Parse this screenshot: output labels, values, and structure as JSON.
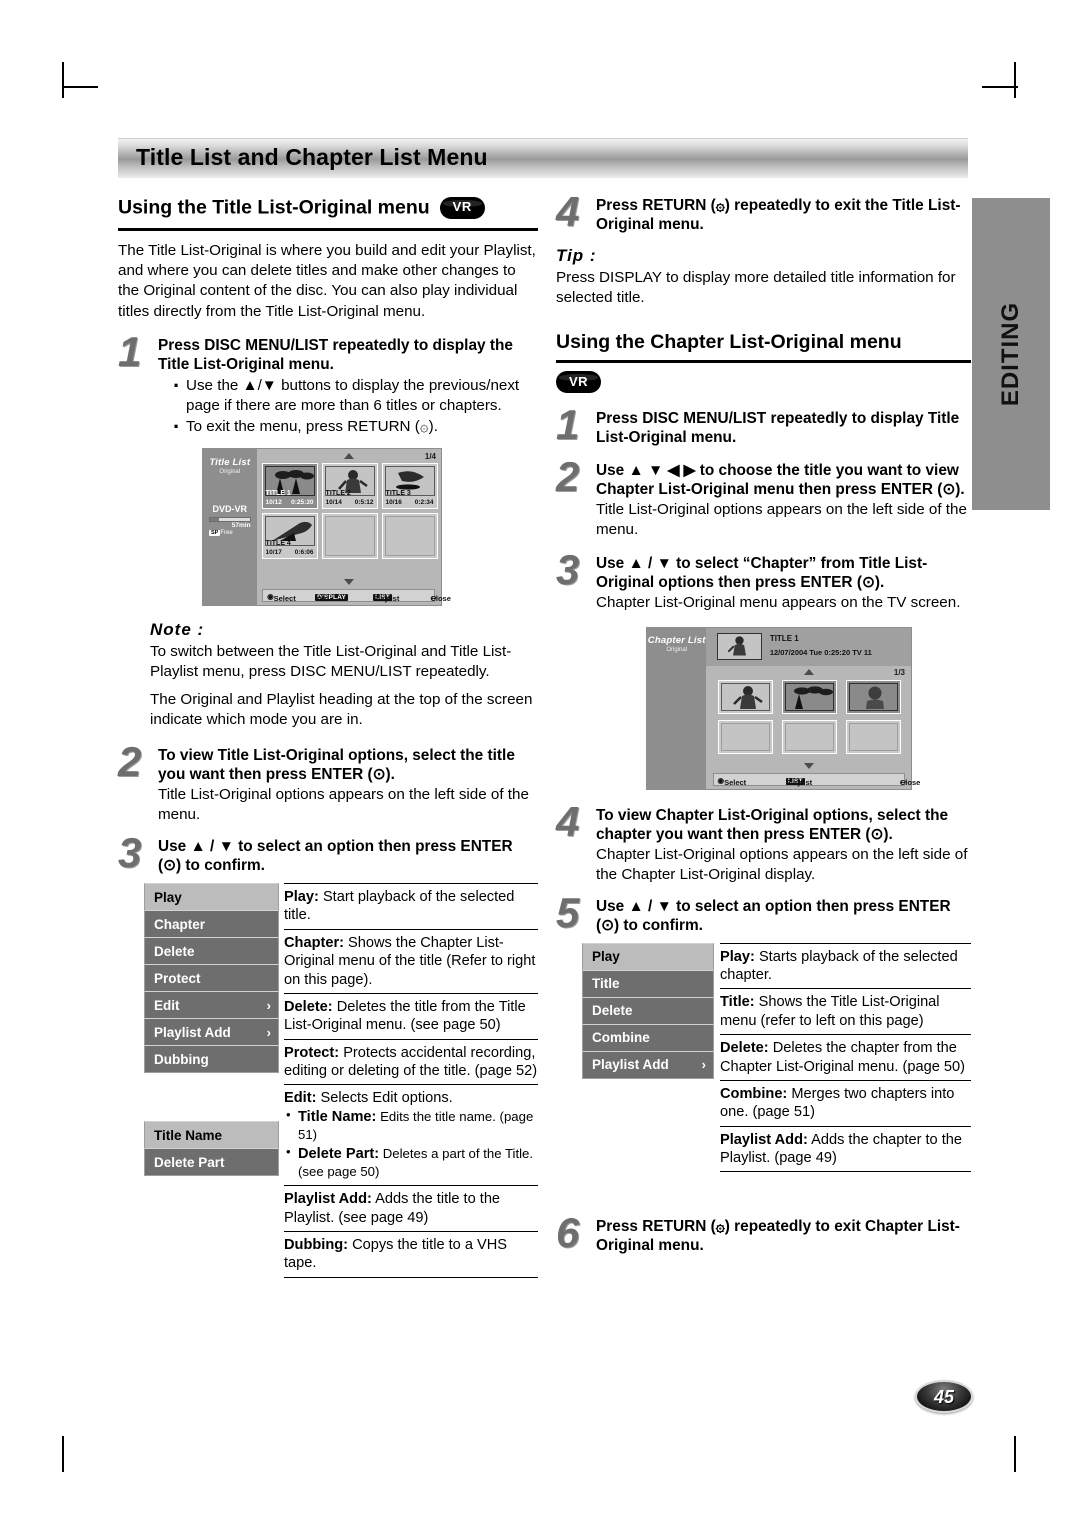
{
  "page": {
    "number": "45",
    "side_tab": "EDITING",
    "title": "Title List and Chapter List Menu"
  },
  "left": {
    "section_heading": "Using the Title List-Original menu",
    "vr_badge": "VR",
    "intro": "The Title List-Original is where you build and edit your Playlist, and where you can delete titles and make other changes to the Original content of the disc. You can also play individual titles directly from the Title List-Original menu.",
    "step1": {
      "num": "1",
      "head": "Press DISC MENU/LIST repeatedly to display the Title List-Original menu.",
      "bullets": [
        "Use the ▲/▼ buttons to display the previous/next page if there are more than 6 titles or chapters.",
        "To exit the menu, press RETURN (۞)."
      ]
    },
    "note": {
      "label": "Note :",
      "para1": "To switch between the Title List-Original and Title List-Playlist menu, press DISC MENU/LIST repeatedly.",
      "para2": "The Original and Playlist heading at the top of the screen indicate which mode you are in."
    },
    "step2": {
      "num": "2",
      "head": "To view Title List-Original options, select the title you want then press ENTER (⊙).",
      "sub": "Title List-Original options appears on the left side of the menu."
    },
    "step3": {
      "num": "3",
      "head": "Use ▲ / ▼ to select an option then press ENTER (⊙) to confirm."
    },
    "options_menu": [
      {
        "label": "Play",
        "selected": true,
        "chevron": false
      },
      {
        "label": "Chapter",
        "selected": false,
        "chevron": false
      },
      {
        "label": "Delete",
        "selected": false,
        "chevron": false
      },
      {
        "label": "Protect",
        "selected": false,
        "chevron": false
      },
      {
        "label": "Edit",
        "selected": false,
        "chevron": true
      },
      {
        "label": "Playlist Add",
        "selected": false,
        "chevron": true
      },
      {
        "label": "Dubbing",
        "selected": false,
        "chevron": false
      }
    ],
    "submenu": [
      {
        "label": "Title Name",
        "selected": true
      },
      {
        "label": "Delete Part",
        "selected": false
      }
    ],
    "descriptions": [
      {
        "term": "Play:",
        "text": " Start playback of the selected title."
      },
      {
        "term": "Chapter:",
        "text": " Shows the Chapter List-Original menu of the title (Refer to right on this page)."
      },
      {
        "term": "Delete:",
        "text": " Deletes the title from the Title List-Original menu. (see page 50)"
      },
      {
        "term": "Protect:",
        "text": " Protects accidental recording, editing or deleting of the title. (page 52)"
      },
      {
        "term": "Edit:",
        "text": " Selects Edit options.",
        "sub_items": [
          {
            "term": "Title Name:",
            "text": " Edits the title name. (page 51)"
          },
          {
            "term": "Delete Part:",
            "text": " Deletes a part of the Title. (see page 50)"
          }
        ]
      },
      {
        "term": "Playlist Add:",
        "text": " Adds the title to the Playlist. (see page 49)"
      },
      {
        "term": "Dubbing:",
        "text": " Copys the title to a VHS tape."
      }
    ]
  },
  "right": {
    "step4_top": {
      "num": "4",
      "head": "Press RETURN (۞) repeatedly to exit the Title List-Original menu."
    },
    "tip": {
      "label": "Tip :",
      "text": "Press DISPLAY to display more detailed title information for selected title."
    },
    "section_heading": "Using the Chapter List-Original menu",
    "vr_badge": "VR",
    "step1": {
      "num": "1",
      "head": "Press DISC MENU/LIST repeatedly to display Title List-Original menu."
    },
    "step2": {
      "num": "2",
      "head": "Use ▲ ▼ ◀ ▶ to choose the title you want to view Chapter List-Original menu then press ENTER (⊙).",
      "sub": "Title List-Original options appears on the left side of the menu."
    },
    "step3": {
      "num": "3",
      "head": "Use ▲ / ▼ to select “Chapter” from Title List-Original options then press ENTER (⊙).",
      "sub": "Chapter List-Original menu appears on the TV screen."
    },
    "step4": {
      "num": "4",
      "head": "To view Chapter List-Original options, select the chapter you want then press ENTER (⊙).",
      "sub": "Chapter List-Original options appears on the left side of the Chapter List-Original display."
    },
    "step5": {
      "num": "5",
      "head": "Use ▲ / ▼ to select an option then press ENTER (⊙) to confirm."
    },
    "options_menu": [
      {
        "label": "Play",
        "selected": true,
        "chevron": false
      },
      {
        "label": "Title",
        "selected": false,
        "chevron": false
      },
      {
        "label": "Delete",
        "selected": false,
        "chevron": false
      },
      {
        "label": "Combine",
        "selected": false,
        "chevron": false
      },
      {
        "label": "Playlist Add",
        "selected": false,
        "chevron": true
      }
    ],
    "descriptions": [
      {
        "term": "Play:",
        "text": " Starts playback of the selected chapter."
      },
      {
        "term": "Title:",
        "text": " Shows the Title List-Original menu (refer to left on this page)"
      },
      {
        "term": "Delete:",
        "text": " Deletes the chapter from the Chapter List-Original menu. (page 50)"
      },
      {
        "term": "Combine:",
        "text": " Merges two chapters into one. (page 51)"
      },
      {
        "term": "Playlist Add:",
        "text": " Adds the chapter to the Playlist. (page 49)"
      }
    ],
    "step6": {
      "num": "6",
      "head": "Press RETURN (۞) repeatedly to exit Chapter List-Original menu."
    }
  },
  "title_list_screen": {
    "panel_title": "Title List",
    "panel_sub": "Original",
    "disc_type": "DVD-VR",
    "remain_label": "Rmain",
    "remain_time": "57min",
    "rec_mode": "SP",
    "free_label": "Free",
    "page_indicator": "1/4",
    "titles": [
      {
        "name": "TITLE 1",
        "date": "10/12",
        "time": "0:25:20",
        "selected": true
      },
      {
        "name": "TITLE 2",
        "date": "10/14",
        "time": "0:5:12",
        "selected": false
      },
      {
        "name": "TITLE 3",
        "date": "10/16",
        "time": "0:2:34",
        "selected": false
      },
      {
        "name": "TITLE 4",
        "date": "10/17",
        "time": "0:6:06",
        "selected": false
      }
    ],
    "bottom_bar": {
      "select": "Select",
      "display_chip": "DISPLAY",
      "info": "Info.",
      "list_chip": "LIST",
      "playlist": "Playlist",
      "close": "Close"
    }
  },
  "chapter_list_screen": {
    "panel_title": "Chapter List",
    "panel_sub": "Original",
    "header_title": "TITLE 1",
    "header_meta": "12/07/2004  Tue 0:25:20   TV 11",
    "page_indicator": "1/3",
    "chapters": [
      {
        "selected": false
      },
      {
        "selected": true
      },
      {
        "selected": true
      }
    ],
    "bottom_bar": {
      "select": "Select",
      "list_chip": "LIST",
      "playlist": "Playlist",
      "close": "Close"
    }
  }
}
